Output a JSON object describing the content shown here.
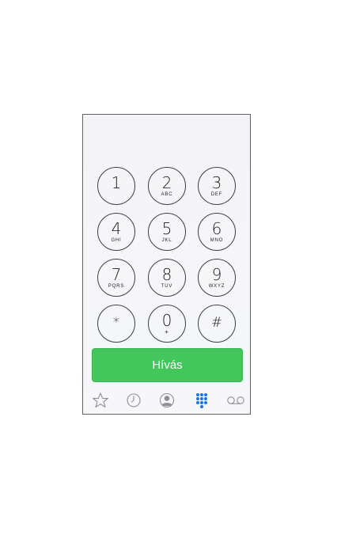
{
  "keypad": {
    "keys": [
      {
        "digit": "1",
        "letters": ""
      },
      {
        "digit": "2",
        "letters": "ABC"
      },
      {
        "digit": "3",
        "letters": "DEF"
      },
      {
        "digit": "4",
        "letters": "GHI"
      },
      {
        "digit": "5",
        "letters": "JKL"
      },
      {
        "digit": "6",
        "letters": "MNO"
      },
      {
        "digit": "7",
        "letters": "PQRS"
      },
      {
        "digit": "8",
        "letters": "TUV"
      },
      {
        "digit": "9",
        "letters": "WXYZ"
      },
      {
        "digit": "*",
        "letters": ""
      },
      {
        "digit": "0",
        "letters": "+"
      },
      {
        "digit": "#",
        "letters": ""
      }
    ]
  },
  "call_button": {
    "label": "Hívás",
    "color": "#43c75d"
  },
  "tabbar": {
    "active_color": "#1a74e8",
    "inactive_color": "#8e8e93",
    "tabs": [
      {
        "icon": "star-icon",
        "active": false
      },
      {
        "icon": "clock-icon",
        "active": false
      },
      {
        "icon": "contact-icon",
        "active": false
      },
      {
        "icon": "keypad-icon",
        "active": true
      },
      {
        "icon": "voicemail-icon",
        "active": false
      }
    ]
  }
}
